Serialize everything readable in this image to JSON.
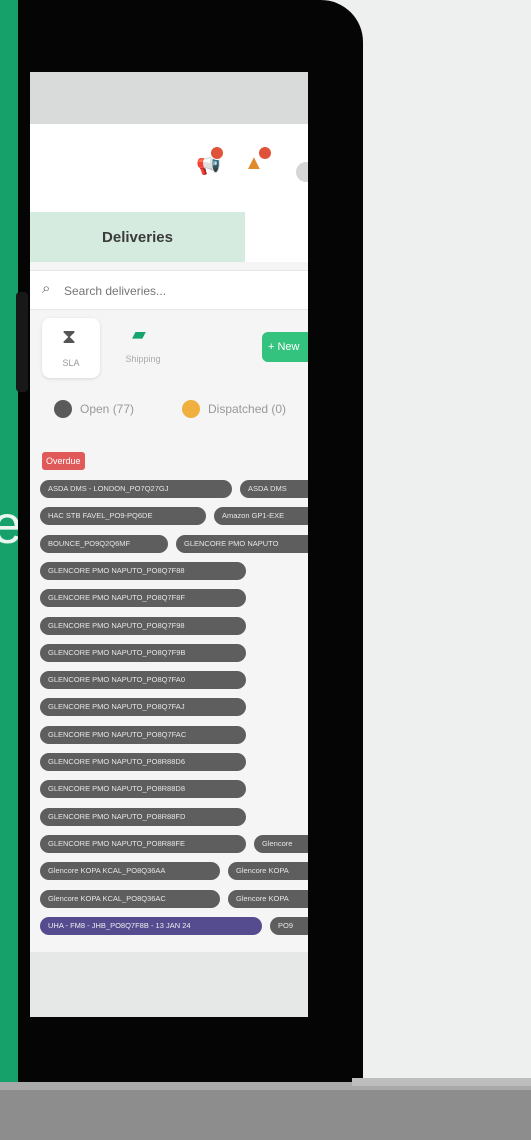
{
  "backdrop": {
    "band_color": "#16a06a",
    "band_letter": "e"
  },
  "app": {
    "header_icons": [
      {
        "name": "megaphone-icon",
        "badge": true
      },
      {
        "name": "warning-icon",
        "badge": true
      }
    ],
    "tabs": [
      {
        "label": "Deliveries",
        "active": true
      },
      {
        "label": "",
        "active": false
      }
    ],
    "search": {
      "placeholder": "Search deliveries..."
    },
    "filters": [
      {
        "label": "SLA",
        "icon": "hourglass-icon"
      },
      {
        "label": "Shipping",
        "icon": "truck-icon"
      }
    ],
    "new_button_label": "+ New",
    "legend": [
      {
        "label": "Open (77)",
        "color": "#5a5a5a"
      },
      {
        "label": "Dispatched (0)",
        "color": "#f0b040"
      }
    ],
    "overdue_label": "Overdue",
    "delivery_chips": [
      [
        "ASDA DMS - LONDON_PO7Q27GJ",
        "ASDA DMS"
      ],
      [
        "HAC STB FAVEL_PO9-PQ6DE",
        "Amazon GP1-EXE"
      ],
      [
        "BOUNCE_PO9Q2Q6MF",
        "GLENCORE PMO NAPUTO"
      ],
      [
        "GLENCORE PMO NAPUTO_PO8Q7F88"
      ],
      [
        "GLENCORE PMO NAPUTO_PO8Q7F8F"
      ],
      [
        "GLENCORE PMO NAPUTO_PO8Q7F98"
      ],
      [
        "GLENCORE PMO NAPUTO_PO8Q7F9B"
      ],
      [
        "GLENCORE PMO NAPUTO_PO8Q7FA0"
      ],
      [
        "GLENCORE PMO NAPUTO_PO8Q7FAJ"
      ],
      [
        "GLENCORE PMO NAPUTO_PO8Q7FAC"
      ],
      [
        "GLENCORE PMO NAPUTO_PO8R88D6"
      ],
      [
        "GLENCORE PMO NAPUTO_PO8R88D8"
      ],
      [
        "GLENCORE PMO NAPUTO_PO8R88FD"
      ],
      [
        "GLENCORE PMO NAPUTO_PO8R88FE",
        "Glencore"
      ],
      [
        "Glencore KOPA KCAL_PO8Q36AA",
        "Glencore KOPA"
      ],
      [
        "Glencore KOPA KCAL_PO8Q36AC",
        "Glencore KOPA"
      ],
      [
        "UHA - FM8 - JHB_PO8Q7F8B - 13 JAN 24",
        "PO9"
      ]
    ],
    "colors": {
      "tab_active_bg": "#d5ebe0",
      "accent_green": "#34c37f",
      "overdue_red": "#e05a5a",
      "chip_gray": "#5e5e5e",
      "chip_purple": "#544c8f"
    }
  }
}
